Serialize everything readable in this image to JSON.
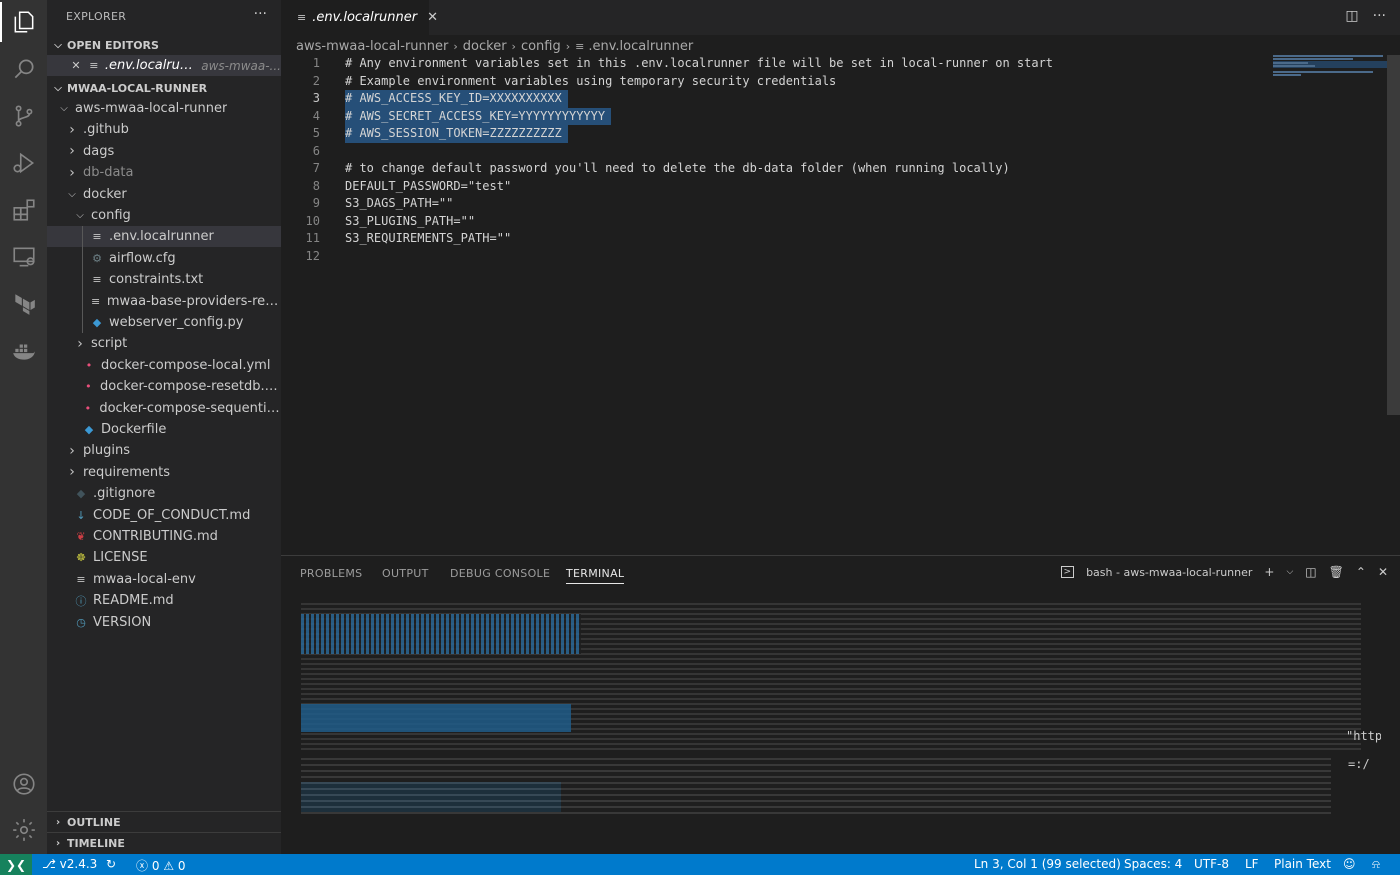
{
  "activity_bar": {
    "items": [
      "explorer-icon",
      "search-icon",
      "source-control-icon",
      "run-debug-icon",
      "extensions-icon",
      "remote-explorer-icon",
      "terraform-icon",
      "docker-icon"
    ],
    "bottom": [
      "account-icon",
      "settings-gear-icon"
    ]
  },
  "sidebar": {
    "title": "EXPLORER",
    "more": "···",
    "open_editors": {
      "label": "OPEN EDITORS",
      "items": [
        {
          "name": ".env.localrunner",
          "desc": "aws-mwaa-..."
        }
      ]
    },
    "workspace": {
      "label": "MWAA-LOCAL-RUNNER",
      "items": [
        {
          "name": "aws-mwaa-local-runner",
          "depth": 1,
          "type": "folder-open"
        },
        {
          "name": ".github",
          "depth": 2,
          "type": "folder"
        },
        {
          "name": "dags",
          "depth": 2,
          "type": "folder"
        },
        {
          "name": "db-data",
          "depth": 2,
          "type": "folder",
          "dim": true
        },
        {
          "name": "docker",
          "depth": 2,
          "type": "folder-open"
        },
        {
          "name": "config",
          "depth": 3,
          "type": "folder-open"
        },
        {
          "name": ".env.localrunner",
          "depth": 4,
          "type": "file",
          "icon": "≡",
          "color": "#c5c5c5",
          "selected": true
        },
        {
          "name": "airflow.cfg",
          "depth": 4,
          "type": "file",
          "icon": "⚙",
          "color": "#6d8086"
        },
        {
          "name": "constraints.txt",
          "depth": 4,
          "type": "file",
          "icon": "≡",
          "color": "#c5c5c5"
        },
        {
          "name": "mwaa-base-providers-requi...",
          "depth": 4,
          "type": "file",
          "icon": "≡",
          "color": "#c5c5c5"
        },
        {
          "name": "webserver_config.py",
          "depth": 4,
          "type": "file",
          "icon": "◆",
          "color": "#3c99d4"
        },
        {
          "name": "script",
          "depth": 3,
          "type": "folder"
        },
        {
          "name": "docker-compose-local.yml",
          "depth": 3,
          "type": "file",
          "icon": "•",
          "color": "#e94f7b"
        },
        {
          "name": "docker-compose-resetdb.yml",
          "depth": 3,
          "type": "file",
          "icon": "•",
          "color": "#e94f7b"
        },
        {
          "name": "docker-compose-sequential....",
          "depth": 3,
          "type": "file",
          "icon": "•",
          "color": "#e94f7b"
        },
        {
          "name": "Dockerfile",
          "depth": 3,
          "type": "file",
          "icon": "◆",
          "color": "#3c99d4"
        },
        {
          "name": "plugins",
          "depth": 2,
          "type": "folder"
        },
        {
          "name": "requirements",
          "depth": 2,
          "type": "folder"
        },
        {
          "name": ".gitignore",
          "depth": 2,
          "type": "file",
          "icon": "◆",
          "color": "#41535b"
        },
        {
          "name": "CODE_OF_CONDUCT.md",
          "depth": 2,
          "type": "file",
          "icon": "↓",
          "color": "#519aba"
        },
        {
          "name": "CONTRIBUTING.md",
          "depth": 2,
          "type": "file",
          "icon": "❦",
          "color": "#cc3e44"
        },
        {
          "name": "LICENSE",
          "depth": 2,
          "type": "file",
          "icon": "☸",
          "color": "#cbcb41"
        },
        {
          "name": "mwaa-local-env",
          "depth": 2,
          "type": "file",
          "icon": "≡",
          "color": "#c5c5c5"
        },
        {
          "name": "README.md",
          "depth": 2,
          "type": "file",
          "icon": "ⓘ",
          "color": "#519aba"
        },
        {
          "name": "VERSION",
          "depth": 2,
          "type": "file",
          "icon": "◷",
          "color": "#519aba"
        }
      ]
    },
    "outline_label": "OUTLINE",
    "timeline_label": "TIMELINE"
  },
  "tab": {
    "title": ".env.localrunner",
    "close": "✕"
  },
  "breadcrumb": [
    "aws-mwaa-local-runner",
    "docker",
    "config",
    ".env.localrunner"
  ],
  "editor": {
    "current_line": 3,
    "lines": [
      {
        "text": "# Any environment variables set in this .env.localrunner file will be set in local-runner on start",
        "sel": false
      },
      {
        "text": "# Example environment variables using temporary security credentials",
        "sel": false
      },
      {
        "text": "# AWS_ACCESS_KEY_ID=XXXXXXXXXX",
        "sel": true
      },
      {
        "text": "# AWS_SECRET_ACCESS_KEY=YYYYYYYYYYYY",
        "sel": true
      },
      {
        "text": "# AWS_SESSION_TOKEN=ZZZZZZZZZZ",
        "sel": true
      },
      {
        "text": "",
        "sel": false
      },
      {
        "text": "# to change default password you'll need to delete the db-data folder (when running locally)",
        "sel": false
      },
      {
        "text": "DEFAULT_PASSWORD=\"test\"",
        "sel": false
      },
      {
        "text": "S3_DAGS_PATH=\"\"",
        "sel": false
      },
      {
        "text": "S3_PLUGINS_PATH=\"\"",
        "sel": false
      },
      {
        "text": "S3_REQUIREMENTS_PATH=\"\"",
        "sel": false
      },
      {
        "text": "",
        "sel": false
      }
    ]
  },
  "panel": {
    "tabs": [
      "PROBLEMS",
      "OUTPUT",
      "DEBUG CONSOLE",
      "TERMINAL"
    ],
    "active": "TERMINAL",
    "terminal_name": "bash - aws-mwaa-local-runner",
    "terminal_fragments": [
      "\"http",
      "=:/"
    ]
  },
  "status": {
    "branch": "v2.4.3",
    "problems_errors": "0",
    "problems_warnings": "0",
    "cursor": "Ln 3, Col 1 (99 selected)",
    "spaces": "Spaces: 4",
    "encoding": "UTF-8",
    "eol": "LF",
    "language": "Plain Text"
  },
  "colors": {
    "accent": "#007acc",
    "remote": "#16825d",
    "selection": "#264f78"
  }
}
